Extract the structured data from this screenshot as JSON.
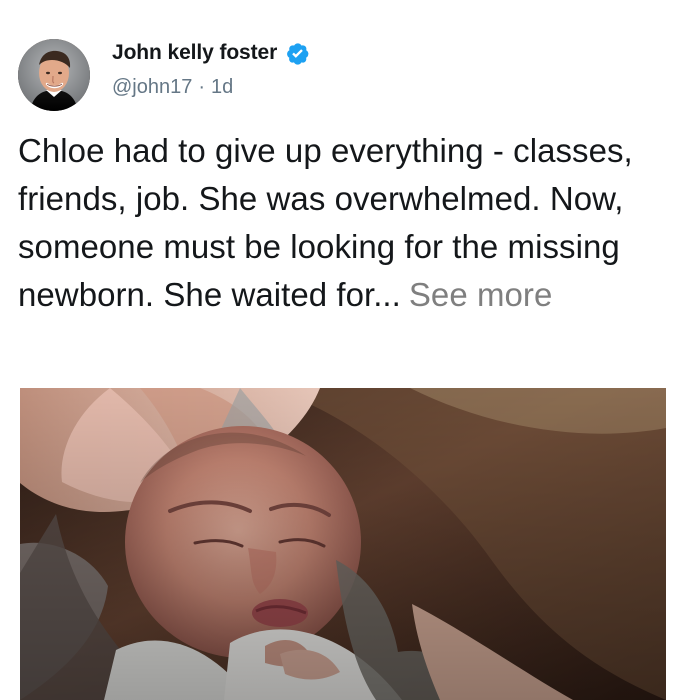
{
  "post": {
    "author": {
      "name": "John kelly foster",
      "handle": "@john17",
      "separator": "·",
      "time": "1d"
    },
    "text": "Chloe had to give up everything - classes, friends, job. She was overwhelmed. Now, someone must be looking for the missing newborn. She waited for...",
    "see_more_label": "See more",
    "icons": {
      "verified": "verified-badge-icon",
      "avatar": "profile-avatar"
    }
  },
  "colors": {
    "verified_blue": "#1da1f2",
    "secondary_text": "#657786",
    "see_more_gray": "#7f7f7f"
  }
}
